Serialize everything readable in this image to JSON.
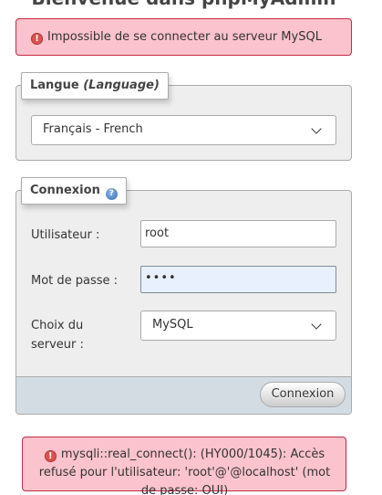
{
  "header": {
    "title": "Bienvenue dans phpMyAdmin"
  },
  "errors": {
    "top_message": "Impossible de se connecter au serveur MySQL",
    "bottom_message": "mysqli::real_connect(): (HY000/1045): Accès refusé pour l'utilisateur: 'root'@'@localhost' (mot de passe: OUI)"
  },
  "language": {
    "legend_prefix": "Langue",
    "legend_italic": "(Language)",
    "selected": "Français - French"
  },
  "connexion": {
    "legend": "Connexion",
    "user_label": "Utilisateur :",
    "user_value": "root",
    "password_label": "Mot de passe :",
    "password_mask": "••••",
    "server_label": "Choix du serveur :",
    "server_selected": "MySQL",
    "submit_label": "Connexion"
  },
  "icons": {
    "error": "error-icon",
    "help": "help-icon",
    "dropdown": "chevron-down-icon"
  },
  "colors": {
    "error_bg": "#fbc3cd",
    "error_border": "#c52b46",
    "fieldset_bg": "#eeeeee",
    "footer_bg": "#d3dce3",
    "autofill_bg": "#e8f0fe"
  }
}
